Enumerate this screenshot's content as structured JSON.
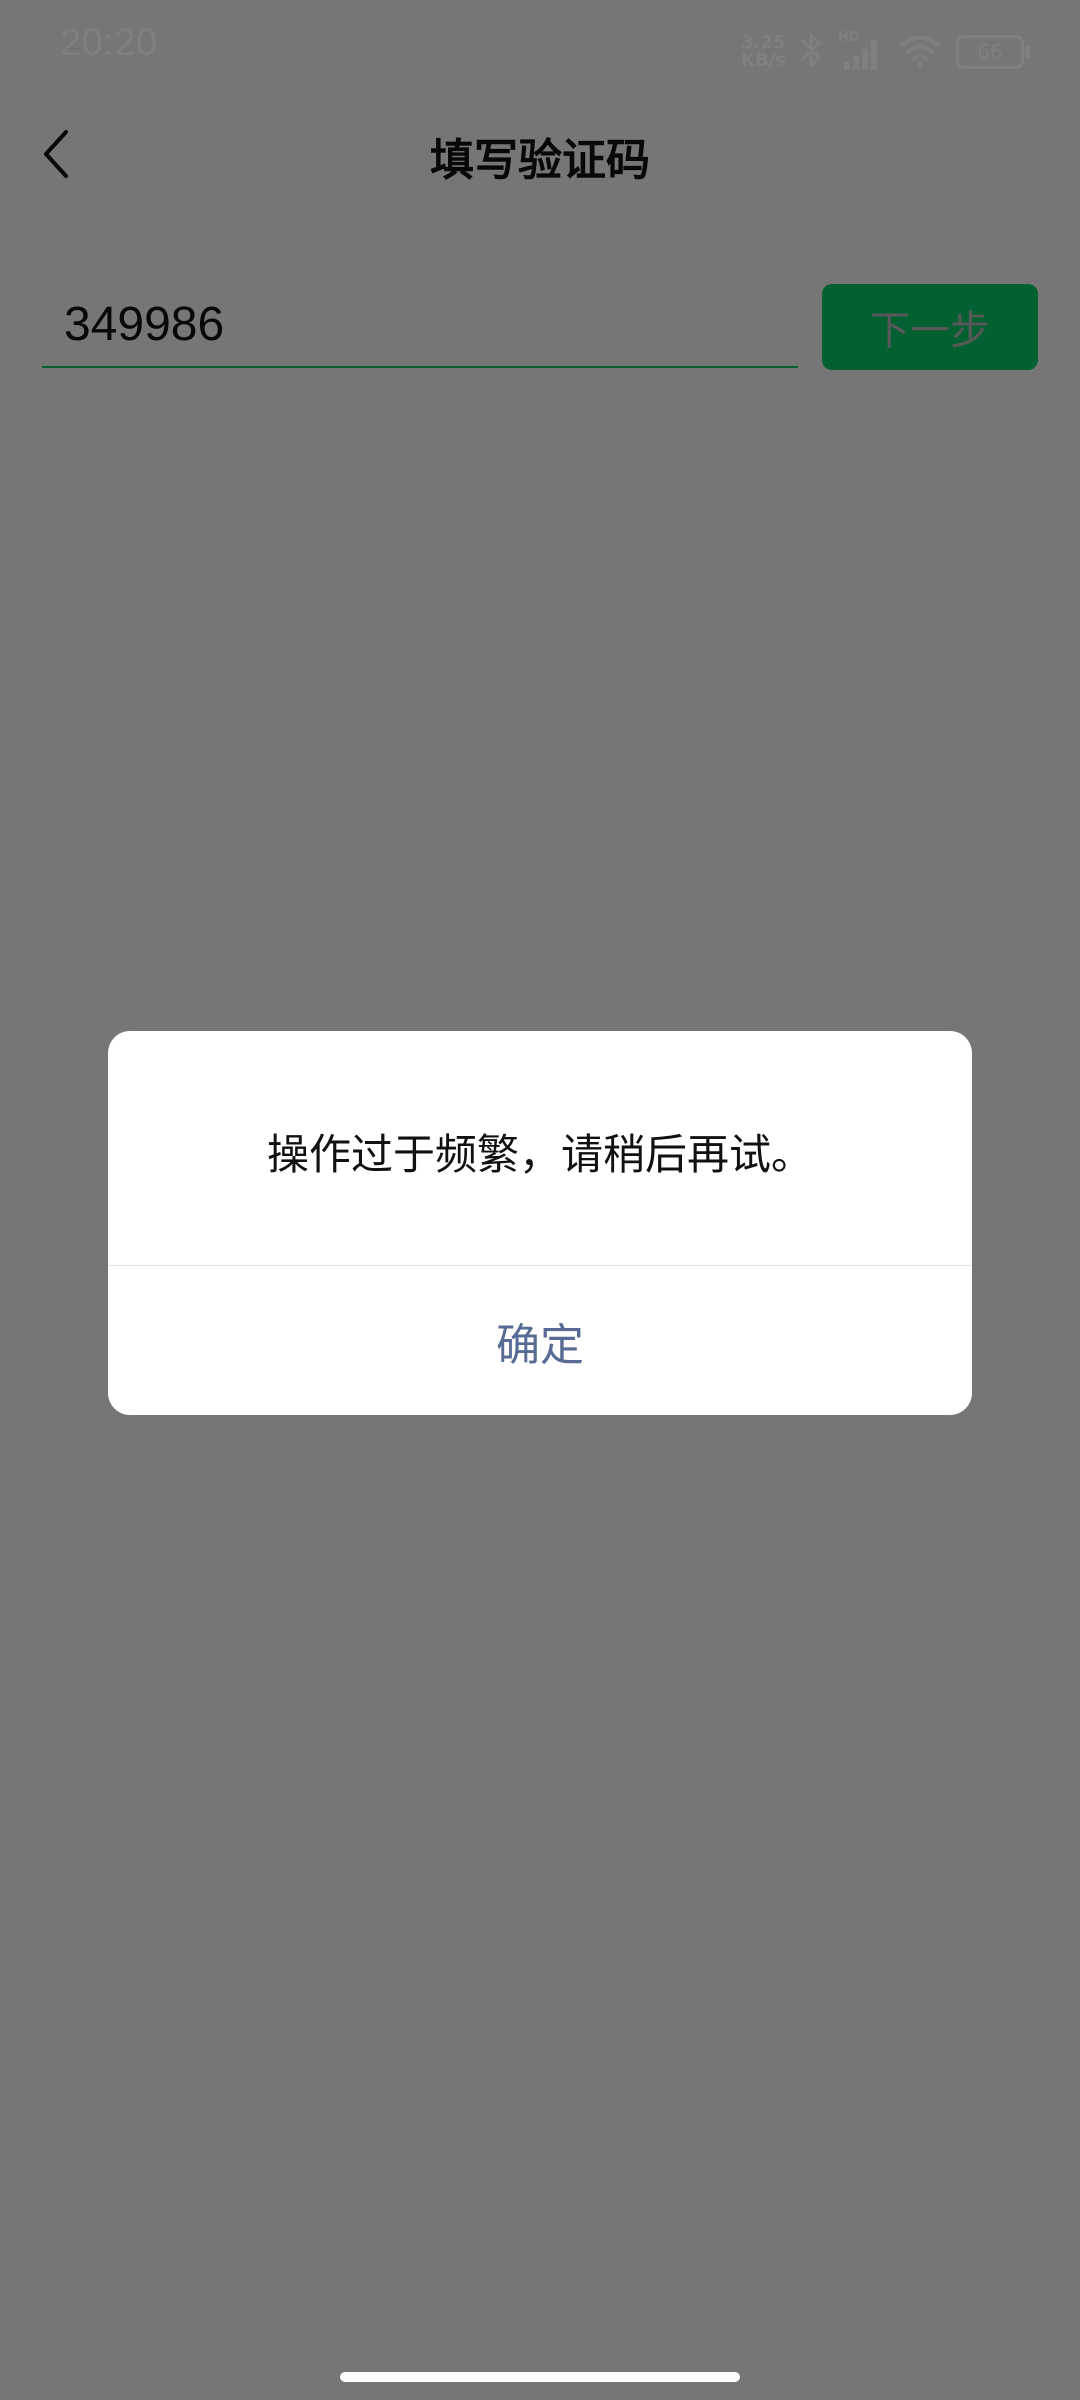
{
  "status_bar": {
    "time": "20:20",
    "net_speed_value": "3.25",
    "net_speed_unit": "KB/s",
    "network_label": "HD",
    "battery_level": "66",
    "icons": [
      "bluetooth-icon",
      "cellular-signal-icon",
      "wifi-icon",
      "battery-icon"
    ]
  },
  "header": {
    "title": "填写验证码",
    "back_icon": "chevron-left-icon"
  },
  "form": {
    "code_value": "349986",
    "next_label": "下一步"
  },
  "dialog": {
    "message": "操作过于频繁，请稍后再试。",
    "confirm_label": "确定"
  },
  "colors": {
    "accent": "#07c160",
    "dialog_button": "#576b95",
    "overlay": "rgba(0,0,0,0.5)"
  }
}
